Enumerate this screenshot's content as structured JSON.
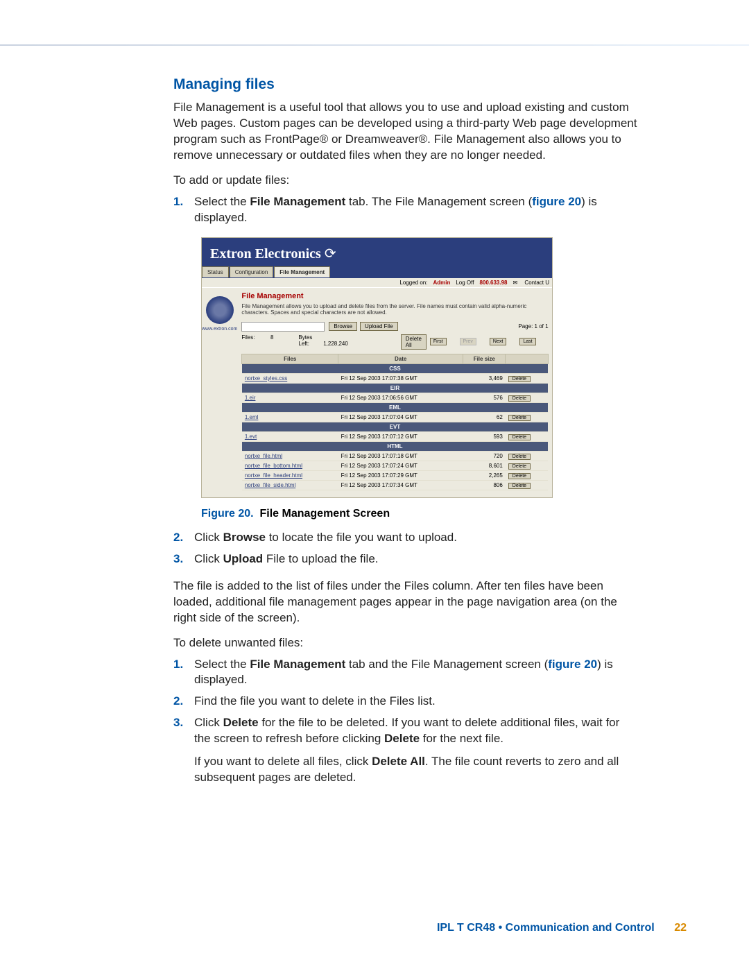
{
  "section_title": "Managing files",
  "intro": "File Management is a useful tool that allows you to use and upload existing and custom Web pages. Custom pages can be developed using a third-party Web page development program such as FrontPage® or Dreamweaver®. File Management also allows you to remove unnecessary or outdated files when they are no longer needed.",
  "lead1": "To add or update files:",
  "steps_a": {
    "s1": {
      "n": "1.",
      "pre": "Select the ",
      "b": "File Management",
      "mid": " tab. The File Management screen (",
      "ref": "figure 20",
      "post": ") is displayed."
    },
    "s2": {
      "n": "2.",
      "pre": "Click ",
      "b": "Browse",
      "post": " to locate the file you want to upload."
    },
    "s3": {
      "n": "3.",
      "pre": "Click ",
      "b": "Upload",
      "post": " File to upload the file."
    }
  },
  "screenshot": {
    "brand": "Extron Electronics",
    "tabs": {
      "status": "Status",
      "config": "Configuration",
      "fm": "File Management"
    },
    "subbar": {
      "logged": "Logged on:",
      "admin": "Admin",
      "logoff": "Log Off",
      "phone": "800.633.98",
      "contact": "Contact U"
    },
    "side": {
      "url": "www.extron.com"
    },
    "title": "File Management",
    "desc": "File Management allows you to upload and delete files from the server. File names must contain valid alpha-numeric characters. Spaces and special characters are not allowed.",
    "btn_browse": "Browse",
    "btn_upload": "Upload File",
    "btn_delall": "Delete All",
    "btn_del": "Delete",
    "page_label": "Page:",
    "page_cur": "1 of",
    "page_total": "1",
    "nav": {
      "first": "First",
      "prev": "Prev",
      "next": "Next",
      "last": "Last"
    },
    "stats": {
      "files_lbl": "Files:",
      "files": "8",
      "bytes_lbl": "Bytes Left:",
      "bytes": "1,228,240"
    },
    "cols": {
      "files": "Files",
      "date": "Date",
      "size": "File size"
    },
    "cats": {
      "css": "CSS",
      "eir": "EIR",
      "eml": "EML",
      "evt": "EVT",
      "html": "HTML"
    },
    "rows": [
      {
        "name": "nortxe_styles.css",
        "date": "Fri 12 Sep 2003 17:07:38 GMT",
        "size": "3,469"
      },
      {
        "name": "1.eir",
        "date": "Fri 12 Sep 2003 17:06:56 GMT",
        "size": "576"
      },
      {
        "name": "1.eml",
        "date": "Fri 12 Sep 2003 17:07:04 GMT",
        "size": "62"
      },
      {
        "name": "1.evt",
        "date": "Fri 12 Sep 2003 17:07:12 GMT",
        "size": "593"
      },
      {
        "name": "nortxe_file.html",
        "date": "Fri 12 Sep 2003 17:07:18 GMT",
        "size": "720"
      },
      {
        "name": "nortxe_file_bottom.html",
        "date": "Fri 12 Sep 2003 17:07:24 GMT",
        "size": "8,601"
      },
      {
        "name": "nortxe_file_header.html",
        "date": "Fri 12 Sep 2003 17:07:29 GMT",
        "size": "2,265"
      },
      {
        "name": "nortxe_file_side.html",
        "date": "Fri 12 Sep 2003 17:07:34 GMT",
        "size": "806"
      }
    ]
  },
  "figcap": {
    "no": "Figure 20.",
    "title": "File Management Screen"
  },
  "para_after": "The file is added to the list of files under the Files column. After ten files have been loaded, additional file management pages appear in the page navigation area (on the right side of the screen).",
  "lead2": "To delete unwanted files:",
  "steps_b": {
    "s1": {
      "n": "1.",
      "pre": "Select the ",
      "b": "File Management",
      "mid": " tab and the File Management screen (",
      "ref": "figure 20",
      "post": ") is displayed."
    },
    "s2": {
      "n": "2.",
      "txt": "Find the file you want to delete in the Files list."
    },
    "s3": {
      "n": "3.",
      "pre": "Click ",
      "b": "Delete",
      "mid": " for the file to be deleted. If you want to delete additional files, wait for the screen to refresh before clicking ",
      "b2": "Delete",
      "post": " for the next file."
    },
    "note": {
      "pre": "If you want to delete all files, click ",
      "b": "Delete All",
      "post": ". The file count reverts to zero and all subsequent pages are deleted."
    }
  },
  "footer": {
    "text": "IPL T CR48 • Communication and Control",
    "page": "22"
  }
}
